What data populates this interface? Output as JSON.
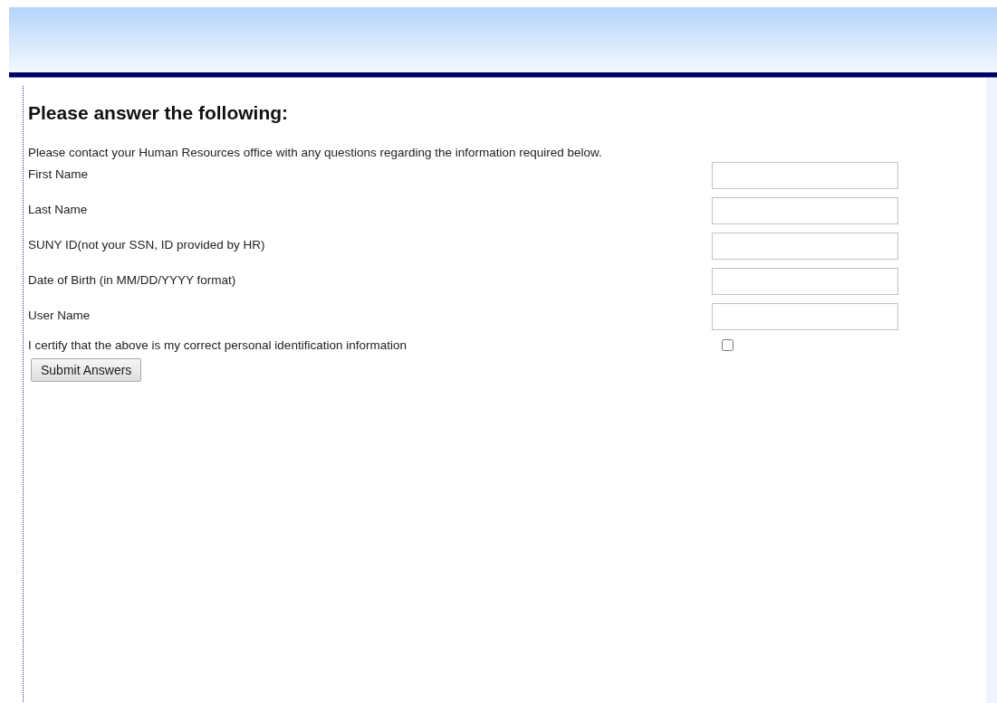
{
  "heading": "Please answer the following:",
  "intro": "Please contact your Human Resources office with any questions regarding the information required below.",
  "fields": [
    {
      "kind": "text",
      "label": "First Name"
    },
    {
      "kind": "text",
      "label": "Last Name"
    },
    {
      "kind": "text",
      "label": "SUNY ID(not your SSN, ID provided by HR)"
    },
    {
      "kind": "text",
      "label": "Date of Birth (in MM/DD/YYYY format)"
    },
    {
      "kind": "text",
      "label": "User Name"
    },
    {
      "kind": "checkbox",
      "label": "I certify that the above is my correct personal identification information",
      "checked": false
    }
  ],
  "submit_button": "Submit Answers"
}
